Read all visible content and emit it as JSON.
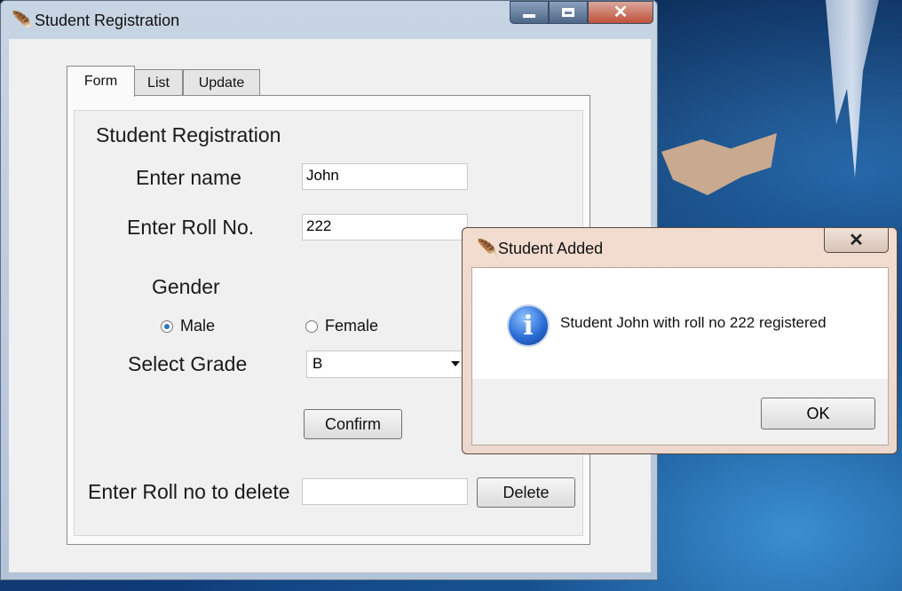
{
  "main_window": {
    "title": "Student Registration",
    "controls": {
      "minimize": "minimize-icon",
      "maximize": "maximize-icon",
      "close": "close-icon"
    }
  },
  "tabs": [
    {
      "label": "Form",
      "active": true
    },
    {
      "label": "List",
      "active": false
    },
    {
      "label": "Update",
      "active": false
    }
  ],
  "form": {
    "heading": "Student Registration",
    "name_label": "Enter name",
    "name_value": "John",
    "roll_label": "Enter Roll No.",
    "roll_value": "222",
    "gender_label": "Gender",
    "gender_options": [
      {
        "label": "Male",
        "selected": true
      },
      {
        "label": "Female",
        "selected": false
      }
    ],
    "grade_label": "Select Grade",
    "grade_value": "B",
    "confirm_label": "Confirm",
    "delete_label": "Enter Roll no to delete",
    "delete_value": "",
    "delete_button": "Delete"
  },
  "dialog": {
    "title": "Student Added",
    "message": "Student John with roll no 222 registered",
    "ok_label": "OK",
    "icon": "info-icon",
    "info_glyph": "i",
    "close_glyph": "✕"
  },
  "icons": {
    "app_icon_glyph": "🪶"
  }
}
